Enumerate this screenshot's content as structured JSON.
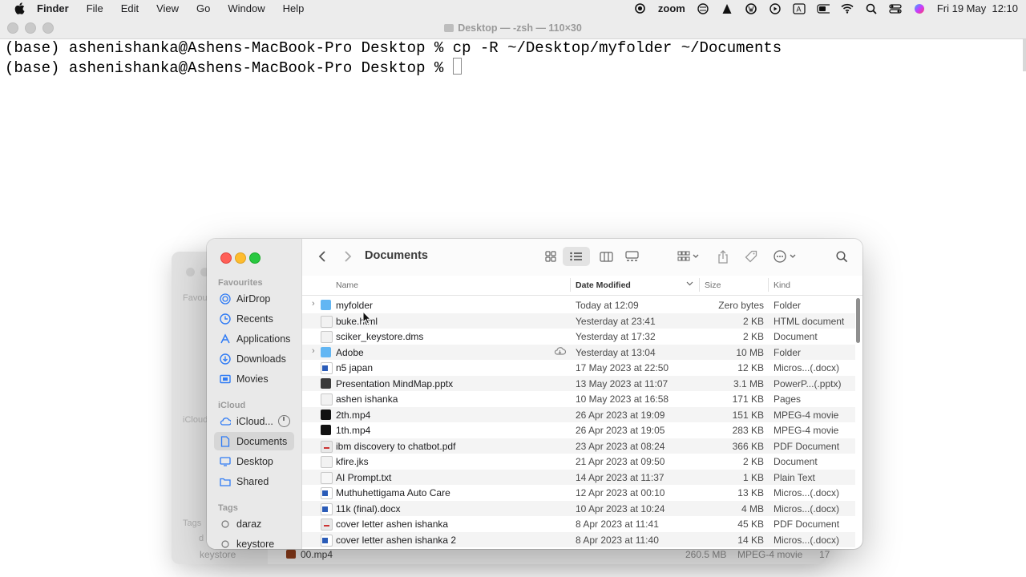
{
  "menubar": {
    "app": "Finder",
    "items": [
      "File",
      "Edit",
      "View",
      "Go",
      "Window",
      "Help"
    ],
    "zoom": "zoom",
    "datetime": "Fri 19 May  12:10"
  },
  "terminal": {
    "title": "Desktop — -zsh — 110×30",
    "line1": "(base) ashenishanka@Ashens-MacBook-Pro Desktop % cp -R ~/Desktop/myfolder ~/Documents",
    "line2": "(base) ashenishanka@Ashens-MacBook-Pro Desktop % "
  },
  "ghost": {
    "side": [
      "Favou",
      "iCloud",
      "Tags",
      "d",
      "keystore"
    ],
    "bottom_file": "00.mp4",
    "bottom_size": "260.5 MB",
    "bottom_kind": "MPEG-4 movie",
    "bottom_extra": "17"
  },
  "finder": {
    "title": "Documents",
    "sidebar": {
      "favourites_label": "Favourites",
      "favourites": [
        "AirDrop",
        "Recents",
        "Applications",
        "Downloads",
        "Movies"
      ],
      "icloud_label": "iCloud",
      "icloud": [
        "iCloud...",
        "Documents",
        "Desktop",
        "Shared"
      ],
      "tags_label": "Tags",
      "tags": [
        "daraz",
        "keystore"
      ]
    },
    "columns": {
      "name": "Name",
      "date": "Date Modified",
      "size": "Size",
      "kind": "Kind"
    },
    "files": [
      {
        "name": "myfolder",
        "date": "Today at 12:09",
        "size": "Zero bytes",
        "kind": "Folder",
        "icon": "folder-icon"
      },
      {
        "name": "buke.html",
        "date": "Yesterday at 23:41",
        "size": "2 KB",
        "kind": "HTML document",
        "icon": "document-icon"
      },
      {
        "name": "sciker_keystore.dms",
        "date": "Yesterday at 17:32",
        "size": "2 KB",
        "kind": "Document",
        "icon": "document-icon"
      },
      {
        "name": "Adobe",
        "date": "Yesterday at 13:04",
        "size": "10 MB",
        "kind": "Folder",
        "icon": "folder-icon"
      },
      {
        "name": "n5 japan",
        "date": "17 May 2023 at 22:50",
        "size": "12 KB",
        "kind": "Micros...(.docx)",
        "icon": "word-icon"
      },
      {
        "name": "Presentation MindMap.pptx",
        "date": "13 May 2023 at 11:07",
        "size": "3.1 MB",
        "kind": "PowerP...(.pptx)",
        "icon": "pptx-icon"
      },
      {
        "name": "ashen ishanka",
        "date": "10 May 2023 at 16:58",
        "size": "171 KB",
        "kind": "Pages",
        "icon": "document-icon"
      },
      {
        "name": "2th.mp4",
        "date": "26 Apr 2023 at 19:09",
        "size": "151 KB",
        "kind": "MPEG-4 movie",
        "icon": "video-icon"
      },
      {
        "name": "1th.mp4",
        "date": "26 Apr 2023 at 19:05",
        "size": "283 KB",
        "kind": "MPEG-4 movie",
        "icon": "video-icon"
      },
      {
        "name": "ibm discovery to chatbot.pdf",
        "date": "23 Apr 2023 at 08:24",
        "size": "366 KB",
        "kind": "PDF Document",
        "icon": "pdf-icon"
      },
      {
        "name": "kfire.jks",
        "date": "21 Apr 2023 at 09:50",
        "size": "2 KB",
        "kind": "Document",
        "icon": "document-icon"
      },
      {
        "name": "AI Prompt.txt",
        "date": "14 Apr 2023 at 11:37",
        "size": "1 KB",
        "kind": "Plain Text",
        "icon": "text-icon"
      },
      {
        "name": "Muthuhettigama Auto Care",
        "date": "12 Apr 2023 at 00:10",
        "size": "13 KB",
        "kind": "Micros...(.docx)",
        "icon": "word-icon"
      },
      {
        "name": "11k (final).docx",
        "date": "10 Apr 2023 at 10:24",
        "size": "4 MB",
        "kind": "Micros...(.docx)",
        "icon": "word-icon"
      },
      {
        "name": "cover letter ashen ishanka",
        "date": "8 Apr 2023 at 11:41",
        "size": "45 KB",
        "kind": "PDF Document",
        "icon": "pdf-icon"
      },
      {
        "name": "cover letter ashen ishanka 2",
        "date": "8 Apr 2023 at 11:40",
        "size": "14 KB",
        "kind": "Micros...(.docx)",
        "icon": "word-icon"
      }
    ]
  }
}
